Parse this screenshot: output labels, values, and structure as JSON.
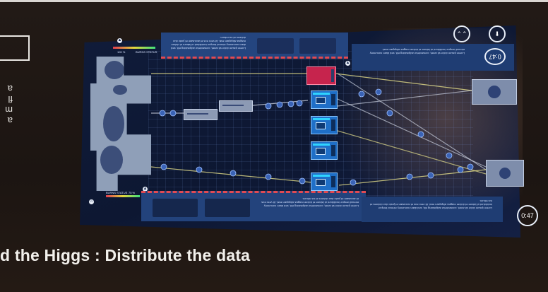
{
  "caption": "d the Higgs : Distribute the data",
  "game": {
    "timer_top": "0:47",
    "timer_bottom": "0:47",
    "status_top": "BURNS STATUS",
    "status_bottom": "BURNS STATUS",
    "percent_top": "100 %",
    "percent_bottom": "75 %",
    "lorem_top": "Lorem ipsum dolor sit amet, consectetur adipisicing elit, sed diam nonummy eirmod tempor incididunt ut labore et dolore magna aliquyam erat. At vero eos et accusam et justo duo dolores et ea rebum.",
    "lorem_right": "Lorem ipsum dolor sit amet, consectetur adipisicing elit, sed diam nonummy eirmod tempor incididunt ut labore et dolore magna aliquyam erat.",
    "lorem_dock": "Lorem ipsum dolor sit amet, consectetur adipisicing elit, sed diam nonummy eirmod tempor incididunt ut labore et dolore magna aliquyam erat. At vero eos et accusam et justo duo dolores et ea rebum.",
    "lorem_info": "Lorem ipsum dolor sit amet, consectetur adipisicing elit, sed diam nonummy eirmod tempor incididunt ut labore et dolore magna aliquyam erat. At vero eos et accusam et justo duo dolores et ea rebum."
  },
  "colors": {
    "screen": "#0d1732",
    "panel": "#24457f",
    "accent_red": "#c6244d",
    "processor": "#1f6fc7",
    "link_yellow": "#e6e08a",
    "link_white": "#dfe6f3"
  },
  "icons": {
    "corner_left": "double-chevron-icon",
    "corner_right": "download-arrow-icon",
    "home": "home-icon"
  }
}
